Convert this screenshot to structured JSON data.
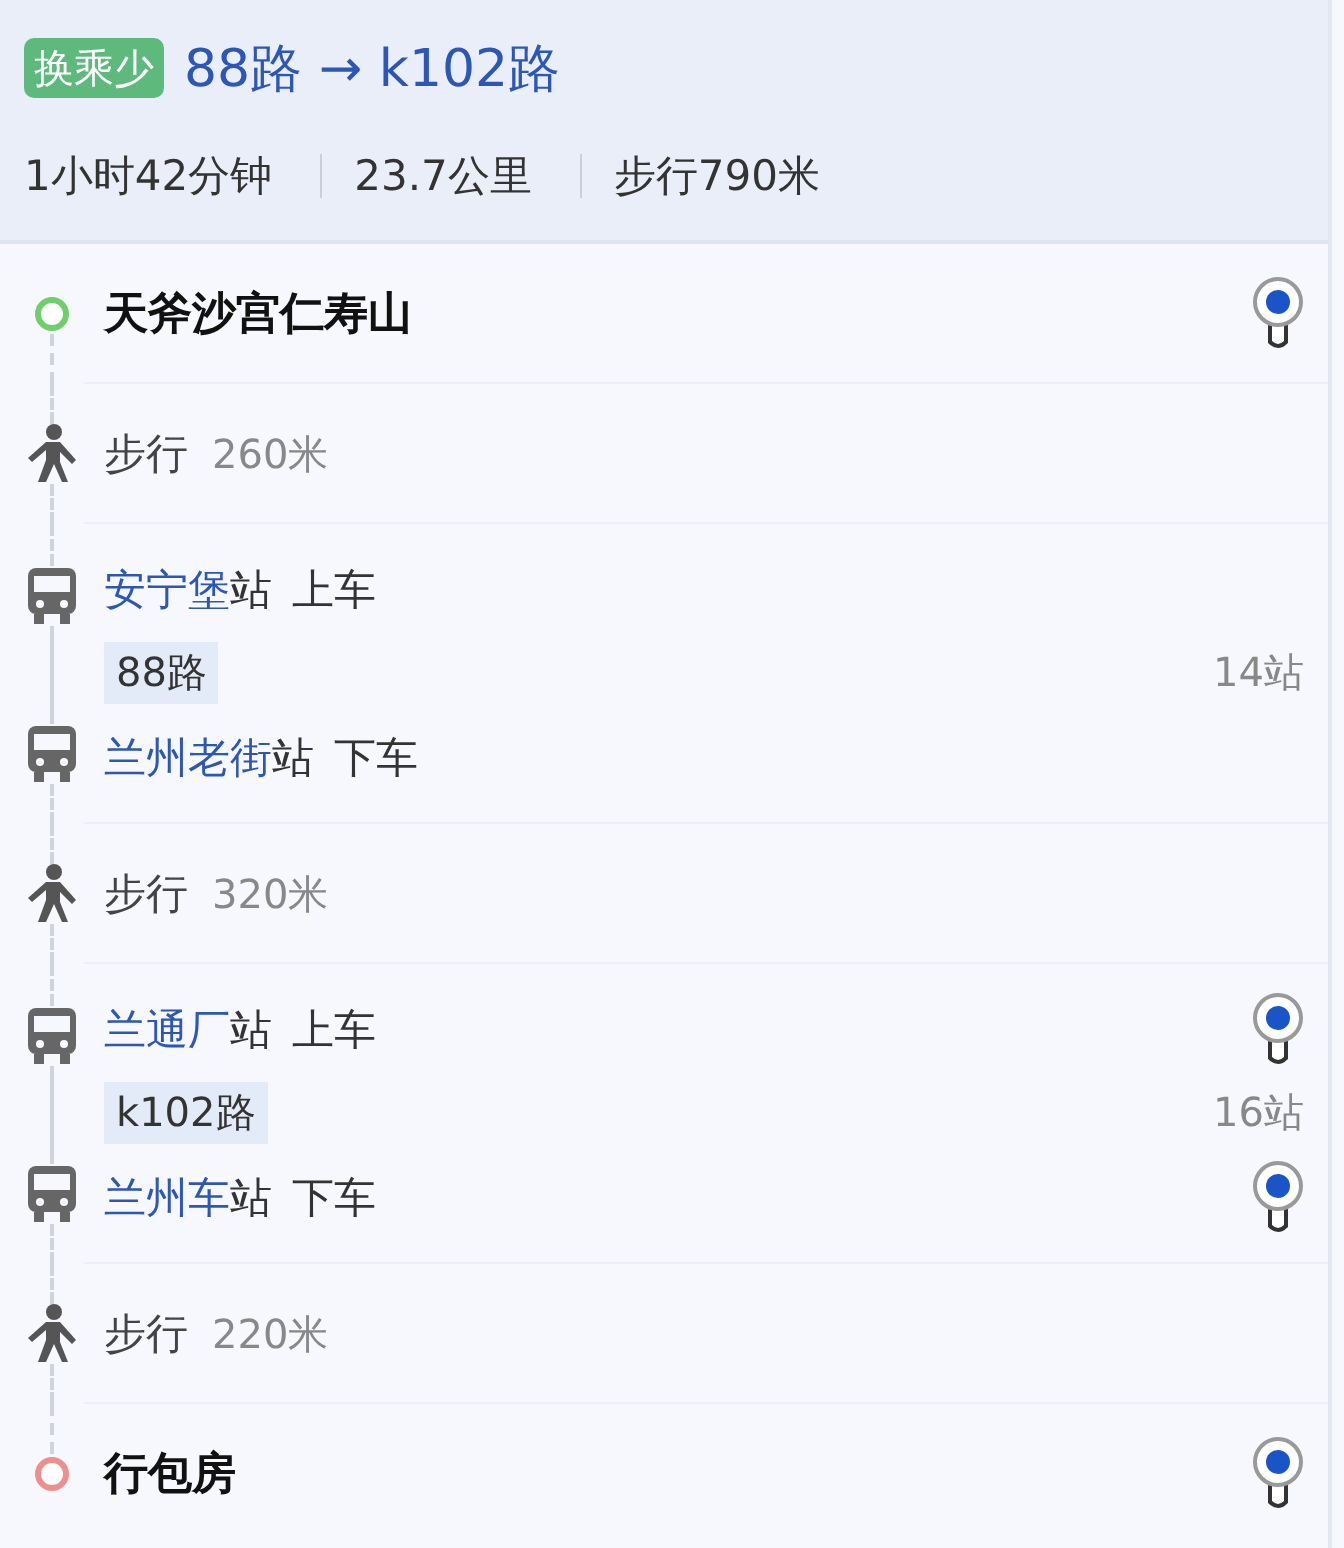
{
  "summary": {
    "tag": "换乘少",
    "route": "88路 → k102路",
    "stats": [
      "1小时42分钟",
      "23.7公里",
      "步行790米"
    ]
  },
  "steps": [
    {
      "kind": "start",
      "name": "天斧沙宫仁寿山",
      "pin": true
    },
    {
      "kind": "walk",
      "label": "步行",
      "distance": "260米"
    },
    {
      "kind": "bus",
      "board": {
        "station": "安宁堡",
        "suffix": "站",
        "action": "上车",
        "pin": false
      },
      "line": "88路",
      "stops": "14站",
      "alight": {
        "station": "兰州老街",
        "suffix": "站",
        "action": "下车",
        "pin": false
      }
    },
    {
      "kind": "walk",
      "label": "步行",
      "distance": "320米"
    },
    {
      "kind": "bus",
      "board": {
        "station": "兰通厂",
        "suffix": "站",
        "action": "上车",
        "pin": true
      },
      "line": "k102路",
      "stops": "16站",
      "alight": {
        "station": "兰州车",
        "suffix": "站",
        "action": "下车",
        "pin": true
      }
    },
    {
      "kind": "walk",
      "label": "步行",
      "distance": "220米"
    },
    {
      "kind": "end",
      "name": "行包房",
      "pin": true
    }
  ]
}
